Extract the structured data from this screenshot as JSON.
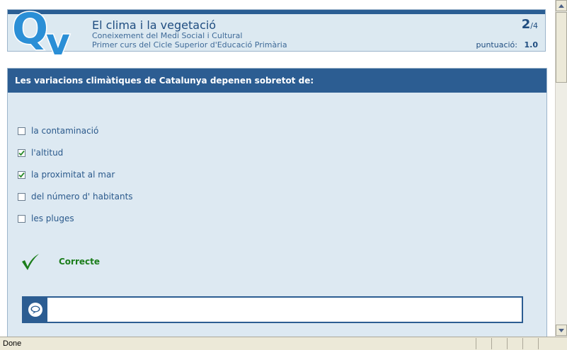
{
  "header": {
    "logo_text": "QV",
    "title": "El clima i la vegetació",
    "subject": "Coneixement del Medi Social i Cultural",
    "course": "Primer curs del Cicle Superior d'Educació Primària",
    "page_current": "2",
    "page_total": "/4",
    "score_label": "puntuació:",
    "score_value": "1.0"
  },
  "question": {
    "text": "Les variacions climàtiques de Catalunya depenen sobretot de:",
    "options": [
      {
        "label": "la contaminació",
        "checked": false
      },
      {
        "label": "l'altitud",
        "checked": true
      },
      {
        "label": "la proximitat al mar",
        "checked": true
      },
      {
        "label": "del número d' habitants",
        "checked": false
      },
      {
        "label": "les pluges",
        "checked": false
      }
    ]
  },
  "feedback": {
    "icon": "checkmark-icon",
    "text": "Correcte"
  },
  "comment": {
    "icon": "speech-bubble-icon",
    "value": ""
  },
  "status_bar": {
    "text": "Done"
  },
  "colors": {
    "accent": "#2c5d92",
    "panel_bg": "#dde9f2",
    "correct": "#1b7d1b"
  }
}
